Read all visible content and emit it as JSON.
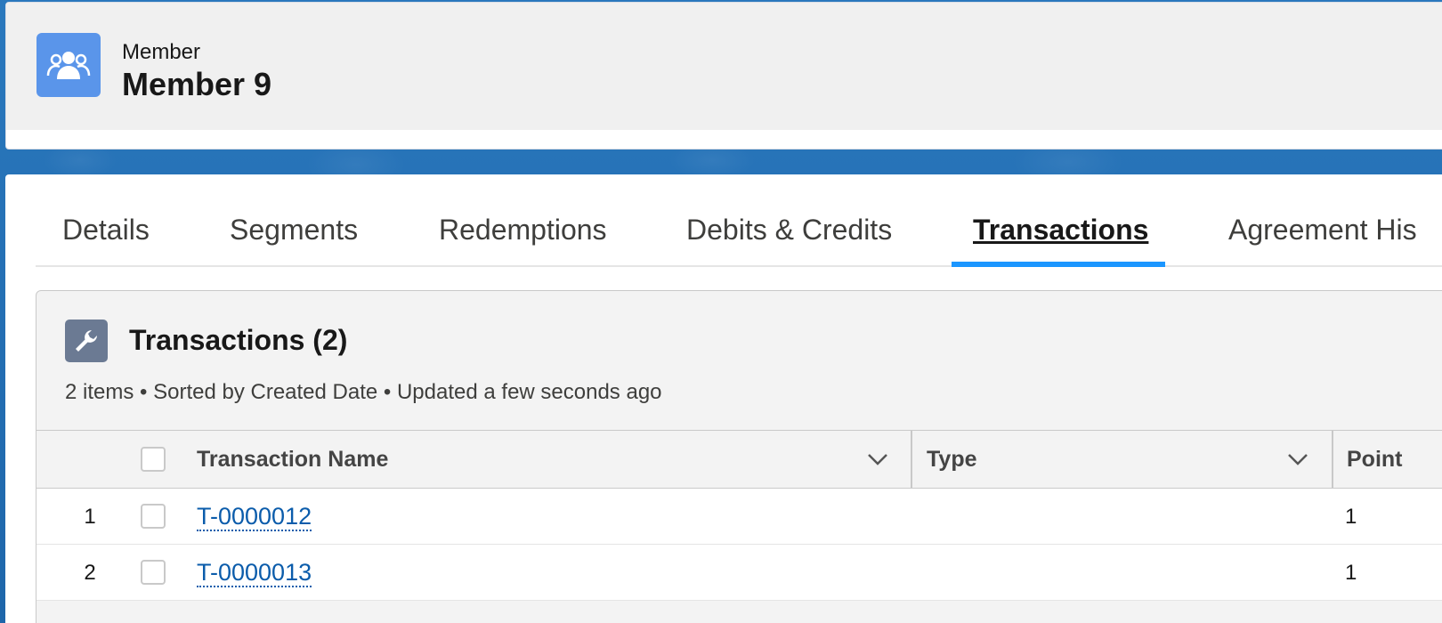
{
  "header": {
    "record_type": "Member",
    "record_name": "Member 9",
    "icon": "members-group-icon"
  },
  "tabs": [
    {
      "label": "Details",
      "active": false
    },
    {
      "label": "Segments",
      "active": false
    },
    {
      "label": "Redemptions",
      "active": false
    },
    {
      "label": "Debits & Credits",
      "active": false
    },
    {
      "label": "Transactions",
      "active": true
    },
    {
      "label": "Agreement His",
      "active": false
    }
  ],
  "related_list": {
    "icon": "wrench-icon",
    "title": "Transactions (2)",
    "meta": "2 items • Sorted by Created Date • Updated a few seconds ago",
    "columns": [
      {
        "label": "Transaction Name"
      },
      {
        "label": "Type"
      },
      {
        "label": "Point"
      }
    ],
    "rows": [
      {
        "num": "1",
        "name": "T-0000012",
        "type": "",
        "points": "1"
      },
      {
        "num": "2",
        "name": "T-0000013",
        "type": "",
        "points": "1"
      }
    ]
  },
  "colors": {
    "accent": "#1b96ff",
    "link": "#0b5cab",
    "record_icon_bg": "#5a95ea",
    "list_icon_bg": "#6b7a93"
  }
}
